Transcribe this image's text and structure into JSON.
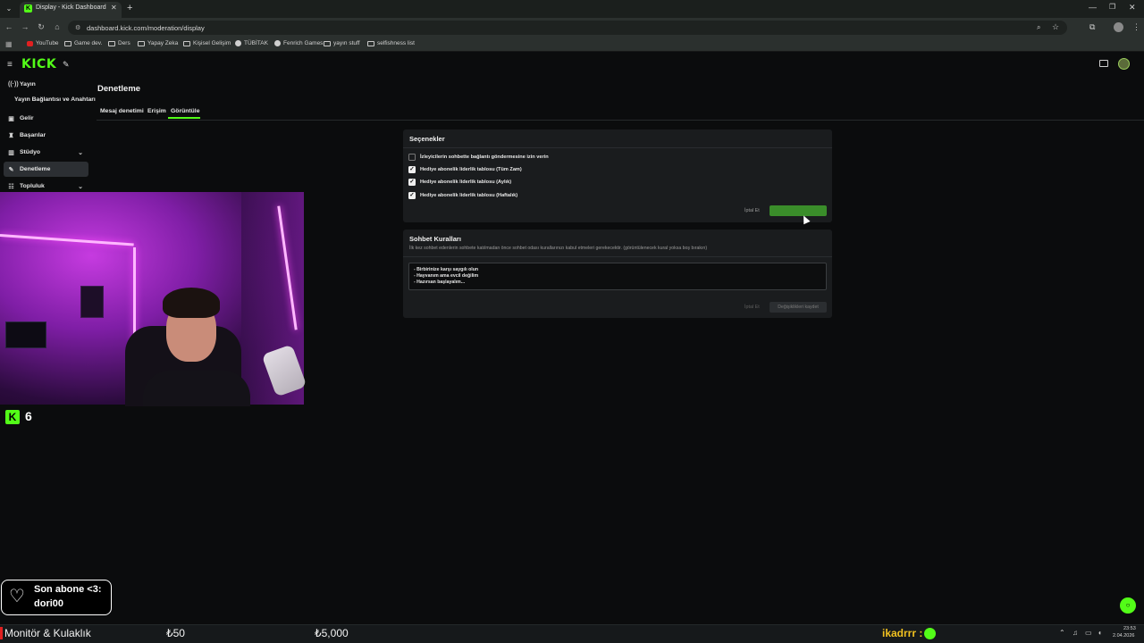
{
  "browser": {
    "tab_title": "Display - Kick Dashboard",
    "url": "dashboard.kick.com/moderation/display",
    "bookmarks": [
      "YouTube",
      "Game dev.",
      "Ders",
      "Yapay Zeka",
      "Kişisel Gelişim",
      "TÜBİTAK",
      "Fenrich Games",
      "yayın stuff",
      "selfishness list"
    ]
  },
  "app": {
    "logo": "KICK",
    "accent_color": "#53fc18"
  },
  "sidebar": {
    "items": [
      {
        "label": "Yayın",
        "icon": "broadcast-icon"
      },
      {
        "label": "Yayın Bağlantısı ve Anahtarı",
        "icon": ""
      },
      {
        "label": "Gelir",
        "icon": "wallet-icon"
      },
      {
        "label": "Başarılar",
        "icon": "trophy-icon"
      },
      {
        "label": "Stüdyo",
        "icon": "studio-icon"
      },
      {
        "label": "Denetleme",
        "icon": "wrench-icon"
      },
      {
        "label": "Topluluk",
        "icon": "community-icon"
      }
    ]
  },
  "page": {
    "title": "Denetleme",
    "tabs": [
      "Mesaj denetimi",
      "Erişim",
      "Görüntüle"
    ],
    "active_tab": "Görüntüle"
  },
  "options_card": {
    "title": "Seçenekler",
    "options": [
      {
        "label": "İzleyicilerin sohbette bağlantı göndermesine izin verin",
        "checked": false
      },
      {
        "label": "Hediye abonelik liderlik tablosu (Tüm Zam)",
        "checked": true
      },
      {
        "label": "Hediye abonelik liderlik tablosu (Aylık)",
        "checked": true
      },
      {
        "label": "Hediye abonelik liderlik tablosu (Haftalık)",
        "checked": true
      }
    ],
    "cancel_label": "İptal Et"
  },
  "rules_card": {
    "title": "Sohbet Kuralları",
    "description": "İlk kez sohbet edenlerin sohbete katılmadan önce sohbet odası kurallarınızı kabul etmeleri gerekecektir. (görüntülenecek kural yoksa boş bırakın)",
    "rules": [
      "- Birbirinize karşı saygılı olun",
      "- Hayvanım ama evcil değilim",
      "- Hazırsan başlayalım..."
    ],
    "cancel_label": "İptal Et",
    "save_label": "Değişiklikleri kaydet"
  },
  "stream_overlay": {
    "kick_count": "6",
    "sub_title": "Son abone <3:",
    "sub_name": "dori00"
  },
  "ticker": {
    "label": "Monitör & Kulaklık",
    "value1": "₺50",
    "value2": "₺5,000",
    "user": "ikadrrr :"
  },
  "clock": {
    "time": "23:53",
    "date": "2.04.2026"
  }
}
